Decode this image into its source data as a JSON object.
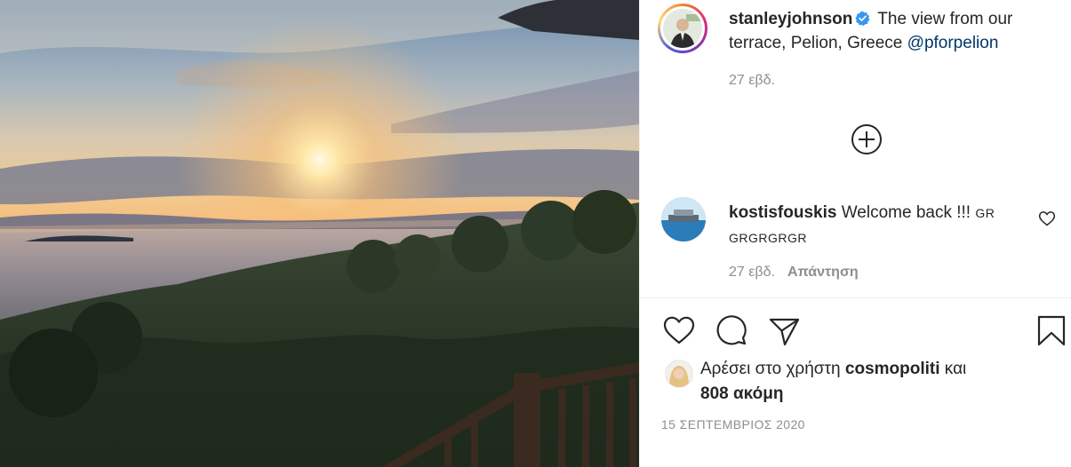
{
  "post": {
    "username": "stanleyjohnson",
    "caption_text": " The view from our terrace, Pelion, Greece ",
    "caption_mention": "@pforpelion",
    "time": "27 εβδ."
  },
  "comment": {
    "username": "kostisfouskis",
    "text": " Welcome back !!! ",
    "tail_line1": "GR",
    "tail_line2": "GRGRGRGR",
    "time": "27 εβδ.",
    "reply_label": "Απάντηση"
  },
  "likes": {
    "prefix": "Αρέσει στο χρήστη ",
    "user": "cosmopoliti",
    "mid": " και",
    "count": "808 ακόμη"
  },
  "date": "15 ΣΕΠΤΕΜΒΡΙΟΣ 2020",
  "icons": {
    "verified": "verified-badge-icon",
    "load_more": "plus-circle-icon",
    "comment_like": "heart-icon",
    "like": "heart-icon",
    "comment": "speech-bubble-icon",
    "share": "paper-plane-icon",
    "save": "bookmark-icon"
  },
  "colors": {
    "text": "#262626",
    "secondary": "#8e8e8e",
    "link": "#00376b",
    "verified": "#3897f0"
  }
}
